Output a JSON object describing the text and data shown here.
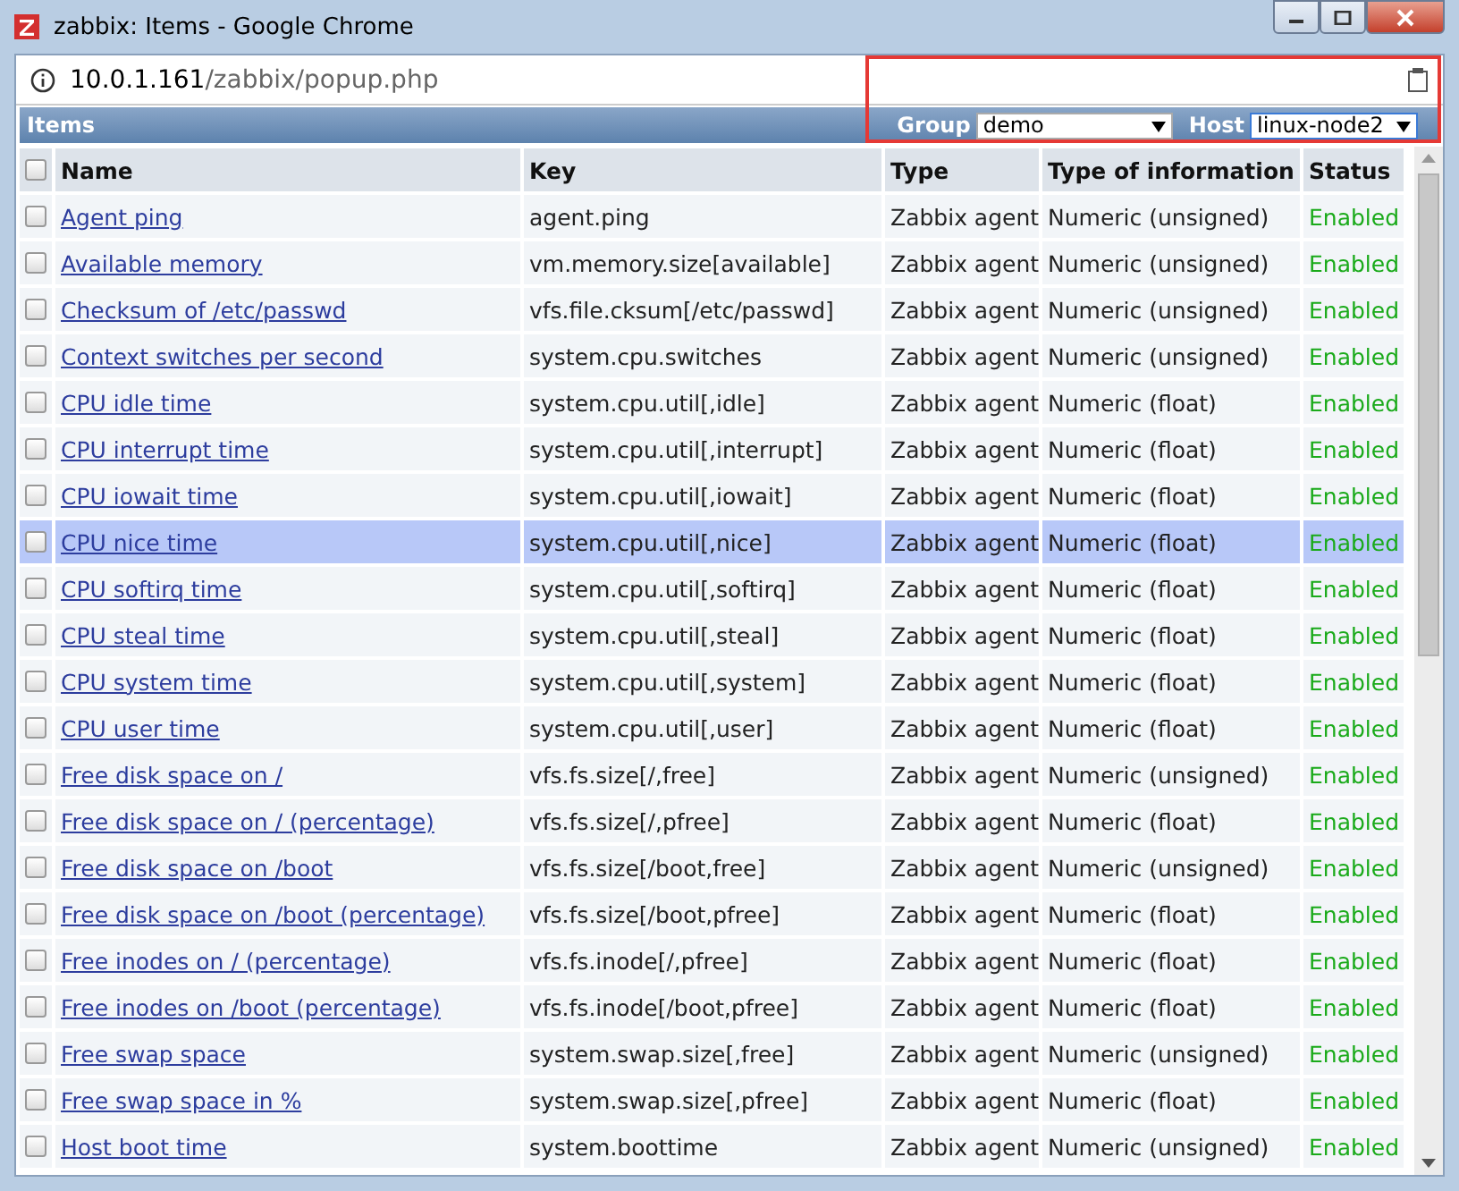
{
  "window": {
    "title": "zabbix: Items - Google Chrome"
  },
  "address_bar": {
    "host": "10.0.1.161",
    "path": "/zabbix/popup.php"
  },
  "panel": {
    "title": "Items",
    "filters": [
      {
        "label": "Group",
        "value": "demo"
      },
      {
        "label": "Host",
        "value": "linux-node2"
      }
    ]
  },
  "table": {
    "select_all_checked": false,
    "columns": [
      "Name",
      "Key",
      "Type",
      "Type of information",
      "Status"
    ],
    "rows": [
      {
        "name": "Agent ping",
        "key": "agent.ping",
        "type": "Zabbix agent",
        "info": "Numeric (unsigned)",
        "status": "Enabled",
        "checked": false,
        "selected": false
      },
      {
        "name": "Available memory",
        "key": "vm.memory.size[available]",
        "type": "Zabbix agent",
        "info": "Numeric (unsigned)",
        "status": "Enabled",
        "checked": false,
        "selected": false
      },
      {
        "name": "Checksum of /etc/passwd",
        "key": "vfs.file.cksum[/etc/passwd]",
        "type": "Zabbix agent",
        "info": "Numeric (unsigned)",
        "status": "Enabled",
        "checked": false,
        "selected": false
      },
      {
        "name": "Context switches per second",
        "key": "system.cpu.switches",
        "type": "Zabbix agent",
        "info": "Numeric (unsigned)",
        "status": "Enabled",
        "checked": false,
        "selected": false
      },
      {
        "name": "CPU idle time",
        "key": "system.cpu.util[,idle]",
        "type": "Zabbix agent",
        "info": "Numeric (float)",
        "status": "Enabled",
        "checked": false,
        "selected": false
      },
      {
        "name": "CPU interrupt time",
        "key": "system.cpu.util[,interrupt]",
        "type": "Zabbix agent",
        "info": "Numeric (float)",
        "status": "Enabled",
        "checked": false,
        "selected": false
      },
      {
        "name": "CPU iowait time",
        "key": "system.cpu.util[,iowait]",
        "type": "Zabbix agent",
        "info": "Numeric (float)",
        "status": "Enabled",
        "checked": false,
        "selected": false
      },
      {
        "name": "CPU nice time",
        "key": "system.cpu.util[,nice]",
        "type": "Zabbix agent",
        "info": "Numeric (float)",
        "status": "Enabled",
        "checked": false,
        "selected": true
      },
      {
        "name": "CPU softirq time",
        "key": "system.cpu.util[,softirq]",
        "type": "Zabbix agent",
        "info": "Numeric (float)",
        "status": "Enabled",
        "checked": false,
        "selected": false
      },
      {
        "name": "CPU steal time",
        "key": "system.cpu.util[,steal]",
        "type": "Zabbix agent",
        "info": "Numeric (float)",
        "status": "Enabled",
        "checked": false,
        "selected": false
      },
      {
        "name": "CPU system time",
        "key": "system.cpu.util[,system]",
        "type": "Zabbix agent",
        "info": "Numeric (float)",
        "status": "Enabled",
        "checked": false,
        "selected": false
      },
      {
        "name": "CPU user time",
        "key": "system.cpu.util[,user]",
        "type": "Zabbix agent",
        "info": "Numeric (float)",
        "status": "Enabled",
        "checked": false,
        "selected": false
      },
      {
        "name": "Free disk space on /",
        "key": "vfs.fs.size[/,free]",
        "type": "Zabbix agent",
        "info": "Numeric (unsigned)",
        "status": "Enabled",
        "checked": false,
        "selected": false
      },
      {
        "name": "Free disk space on / (percentage)",
        "key": "vfs.fs.size[/,pfree]",
        "type": "Zabbix agent",
        "info": "Numeric (float)",
        "status": "Enabled",
        "checked": false,
        "selected": false
      },
      {
        "name": "Free disk space on /boot",
        "key": "vfs.fs.size[/boot,free]",
        "type": "Zabbix agent",
        "info": "Numeric (unsigned)",
        "status": "Enabled",
        "checked": false,
        "selected": false
      },
      {
        "name": "Free disk space on /boot (percentage)",
        "key": "vfs.fs.size[/boot,pfree]",
        "type": "Zabbix agent",
        "info": "Numeric (float)",
        "status": "Enabled",
        "checked": false,
        "selected": false
      },
      {
        "name": "Free inodes on / (percentage)",
        "key": "vfs.fs.inode[/,pfree]",
        "type": "Zabbix agent",
        "info": "Numeric (float)",
        "status": "Enabled",
        "checked": false,
        "selected": false
      },
      {
        "name": "Free inodes on /boot (percentage)",
        "key": "vfs.fs.inode[/boot,pfree]",
        "type": "Zabbix agent",
        "info": "Numeric (float)",
        "status": "Enabled",
        "checked": false,
        "selected": false
      },
      {
        "name": "Free swap space",
        "key": "system.swap.size[,free]",
        "type": "Zabbix agent",
        "info": "Numeric (unsigned)",
        "status": "Enabled",
        "checked": false,
        "selected": false
      },
      {
        "name": "Free swap space in %",
        "key": "system.swap.size[,pfree]",
        "type": "Zabbix agent",
        "info": "Numeric (float)",
        "status": "Enabled",
        "checked": false,
        "selected": false
      },
      {
        "name": "Host boot time",
        "key": "system.boottime",
        "type": "Zabbix agent",
        "info": "Numeric (unsigned)",
        "status": "Enabled",
        "checked": false,
        "selected": false
      }
    ]
  }
}
